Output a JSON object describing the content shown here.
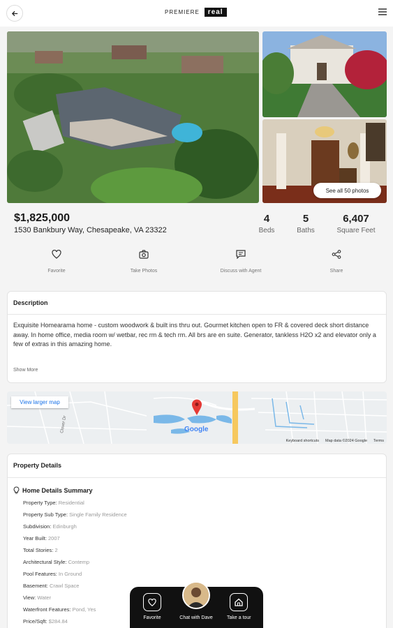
{
  "header": {
    "brand_prefix": "PREMIERE",
    "brand_name": "real"
  },
  "photos": {
    "see_all_label": "See all 50 photos"
  },
  "listing": {
    "price": "$1,825,000",
    "address": "1530 Bankbury Way, Chesapeake, VA 23322",
    "stats": [
      {
        "value": "4",
        "label": "Beds"
      },
      {
        "value": "5",
        "label": "Baths"
      },
      {
        "value": "6,407",
        "label": "Square Feet"
      }
    ]
  },
  "actions": [
    {
      "label": "Favorite",
      "icon": "heart-icon"
    },
    {
      "label": "Take Photos",
      "icon": "camera-icon"
    },
    {
      "label": "Discuss with Agent",
      "icon": "chat-icon"
    },
    {
      "label": "Share",
      "icon": "share-icon"
    }
  ],
  "description": {
    "title": "Description",
    "text": "Exquisite Homearama home - custom woodwork & built ins thru out. Gourmet kitchen open to FR & covered deck short distance away. In home office, media room w/ wetbar, rec rm & tech rm. All brs are en suite. Generator, tankless H2O x2 and elevator only a few of extras in this amazing home.",
    "show_more": "Show More"
  },
  "map": {
    "view_larger": "View larger map",
    "logo": "Google",
    "footer": [
      "Keyboard shortcuts",
      "Map data ©2024 Google",
      "Terms"
    ],
    "street_label": "Clover Dr"
  },
  "details": {
    "title": "Property Details",
    "section_title": "Home Details Summary",
    "rows": [
      {
        "key": "Property Type:",
        "value": "Residential"
      },
      {
        "key": "Property Sub Type:",
        "value": "Single Family Residence"
      },
      {
        "key": "Subdivision:",
        "value": "Edinburgh"
      },
      {
        "key": "Year Built:",
        "value": "2007"
      },
      {
        "key": "Total Stories:",
        "value": "2"
      },
      {
        "key": "Architectural Style:",
        "value": "Contemp"
      },
      {
        "key": "Pool Features:",
        "value": "In Ground"
      },
      {
        "key": "Basement:",
        "value": "Crawl Space"
      },
      {
        "key": "View:",
        "value": "Water"
      },
      {
        "key": "Waterfront Features:",
        "value": "Pond, Yes"
      },
      {
        "key": "Price/Sqft:",
        "value": "$284.84"
      }
    ]
  },
  "bottom_bar": {
    "favorite": "Favorite",
    "chat": "Chat with Dave",
    "tour": "Take a tour"
  },
  "colors": {
    "accent": "#1a73e8",
    "pin": "#e53935",
    "bar": "#111111",
    "water": "#7ab8e8",
    "road_major": "#f6c85f"
  }
}
